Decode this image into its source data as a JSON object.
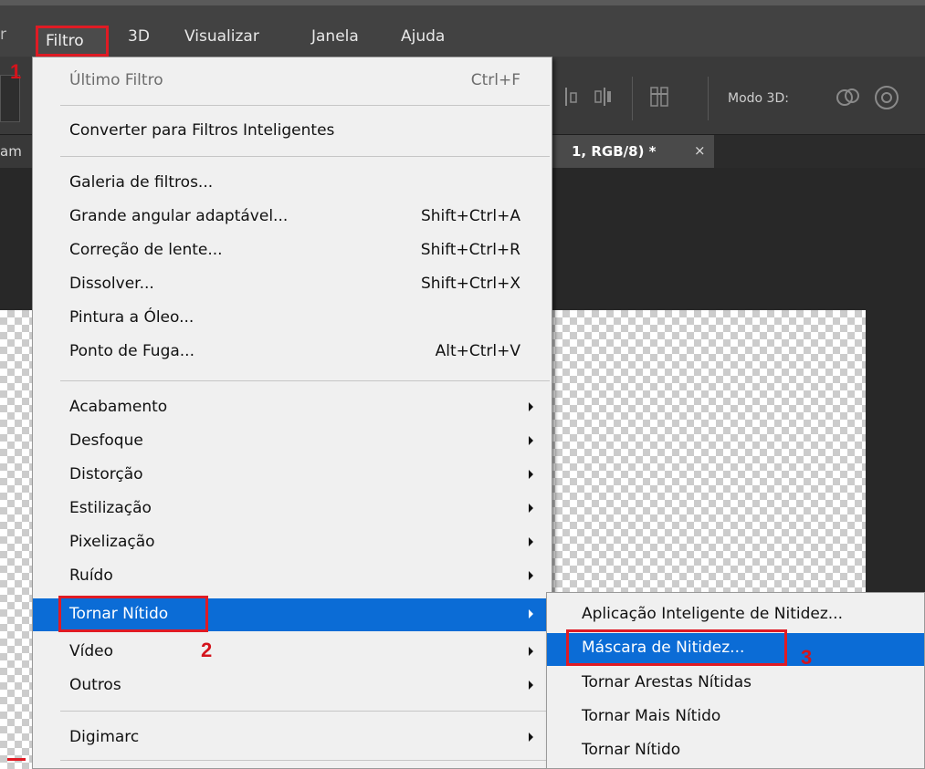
{
  "menubar": {
    "partial_left": "r",
    "items": [
      "Filtro",
      "3D",
      "Visualizar",
      "Janela",
      "Ajuda"
    ]
  },
  "options_bar": {
    "mode_label": "Modo 3D:"
  },
  "tabs": {
    "left_partial": "am",
    "active_partial": "1, RGB/8) *",
    "close_glyph": "×"
  },
  "filter_menu": {
    "items": [
      {
        "label": "Último Filtro",
        "shortcut": "Ctrl+F",
        "disabled": true
      },
      {
        "label": "Converter para Filtros Inteligentes",
        "shortcut": ""
      },
      {
        "label": "Galeria de filtros...",
        "shortcut": ""
      },
      {
        "label": "Grande angular adaptável...",
        "shortcut": "Shift+Ctrl+A"
      },
      {
        "label": "Correção de lente...",
        "shortcut": "Shift+Ctrl+R"
      },
      {
        "label": "Dissolver...",
        "shortcut": "Shift+Ctrl+X"
      },
      {
        "label": "Pintura a Óleo...",
        "shortcut": ""
      },
      {
        "label": "Ponto de Fuga...",
        "shortcut": "Alt+Ctrl+V"
      },
      {
        "label": "Acabamento",
        "submenu": true
      },
      {
        "label": "Desfoque",
        "submenu": true
      },
      {
        "label": "Distorção",
        "submenu": true
      },
      {
        "label": "Estilização",
        "submenu": true
      },
      {
        "label": "Pixelização",
        "submenu": true
      },
      {
        "label": "Ruído",
        "submenu": true
      },
      {
        "label": "Tornar Nítido",
        "submenu": true,
        "highlighted": true
      },
      {
        "label": "Vídeo",
        "submenu": true
      },
      {
        "label": "Outros",
        "submenu": true
      },
      {
        "label": "Digimarc",
        "submenu": true
      }
    ]
  },
  "sharpen_submenu": {
    "items": [
      {
        "label": "Aplicação Inteligente de Nitidez..."
      },
      {
        "label": "Máscara de Nitidez...",
        "highlighted": true
      },
      {
        "label": "Tornar Arestas Nítidas"
      },
      {
        "label": "Tornar Mais Nítido"
      },
      {
        "label": "Tornar Nítido"
      }
    ]
  },
  "annotations": {
    "step1": "1",
    "step2": "2",
    "step3": "3",
    "marker_color": "#e01b24"
  },
  "colors": {
    "highlight": "#0b6cd6",
    "menu_bg": "#f0f0f0",
    "app_bg": "#282828"
  }
}
